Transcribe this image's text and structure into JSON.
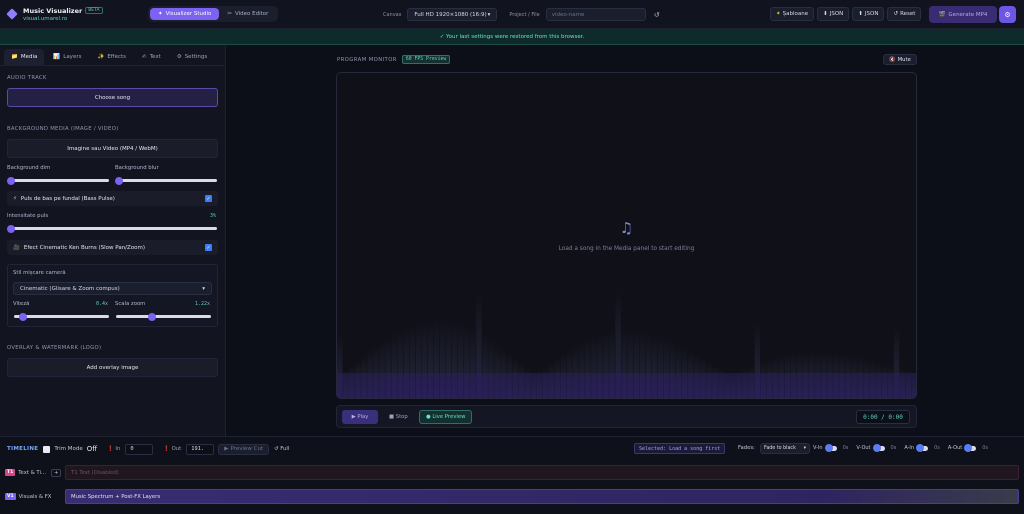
{
  "app": {
    "name": "Music Visualizer",
    "badge": "BETA",
    "subdomain": "visual.umarel.ro"
  },
  "modes": [
    "Visualizer Studio",
    "Video Editor"
  ],
  "header": {
    "canvas_label": "Canvas",
    "canvas_value": "Full HD 1920×1080 (16:9)",
    "project_label": "Project / File",
    "project_placeholder": "video-name",
    "reload_icon": "↺",
    "templates": "Șabloane",
    "json_down": "JSON",
    "json_up": "JSON",
    "reset": "Reset",
    "generate": "Generate MP4"
  },
  "notice": "✓ Your last settings were restored from this browser.",
  "tabs": [
    "Media",
    "Layers",
    "Effects",
    "Text",
    "Settings"
  ],
  "media": {
    "audio_title": "AUDIO TRACK",
    "choose_song": "Choose song",
    "bg_title": "BACKGROUND MEDIA (IMAGE / VIDEO)",
    "bg_button": "Imagine sau Video (MP4 / WebM)",
    "dim_label": "Background dim",
    "blur_label": "Background blur",
    "bass_pulse": "Puls de bas pe fundal (Bass Pulse)",
    "pulse_intensity_label": "Intensitate puls",
    "pulse_intensity_value": "3%",
    "ken_burns": "Efect Cinematic Ken Burns (Slow Pan/Zoom)",
    "camera_style_label": "Stil mișcare cameră",
    "camera_style_value": "Cinematic (Glisare & Zoom compus)",
    "speed_label": "Viteză",
    "speed_value": "0.4x",
    "zoom_label": "Scala zoom",
    "zoom_value": "1.22x",
    "overlay_title": "OVERLAY & WATERMARK (LOGO)",
    "overlay_button": "Add overlay image"
  },
  "monitor": {
    "title": "PROGRAM MONITOR",
    "fps": "60 FPS Preview",
    "mute": "Mute",
    "empty_message": "Load a song in the Media panel to start editing",
    "play": "Play",
    "stop": "Stop",
    "live_preview": "Live Preview",
    "time": "0:00 / 0:00"
  },
  "timeline": {
    "title": "TIMELINE",
    "trim_mode": "Trim Mode",
    "trim_state": "Off",
    "in_label": "In",
    "in_value": "0",
    "out_label": "Out",
    "out_value": "191.",
    "preview_cut": "Preview Cut",
    "full": "Full",
    "selected": "Selected: Load a song first",
    "fades_label": "Fades:",
    "fade_mode": "Fade to black",
    "v_in": "V-In",
    "v_in_val": "0s",
    "v_out": "V-Out",
    "v_out_val": "0s",
    "a_in": "A-In",
    "a_in_val": "0s",
    "a_out": "A-Out",
    "a_out_val": "0s",
    "tracks": [
      {
        "tag": "T1",
        "name": "Text & Ti...",
        "clip": "T1 Text (Disabled)"
      },
      {
        "tag": "V1",
        "name": "Visuals & FX",
        "clip": "Music Spectrum + Post-FX Layers"
      }
    ]
  },
  "colors": {
    "accent": "#7c62f0",
    "teal": "#59d3c4",
    "bg": "#0b0d16"
  }
}
